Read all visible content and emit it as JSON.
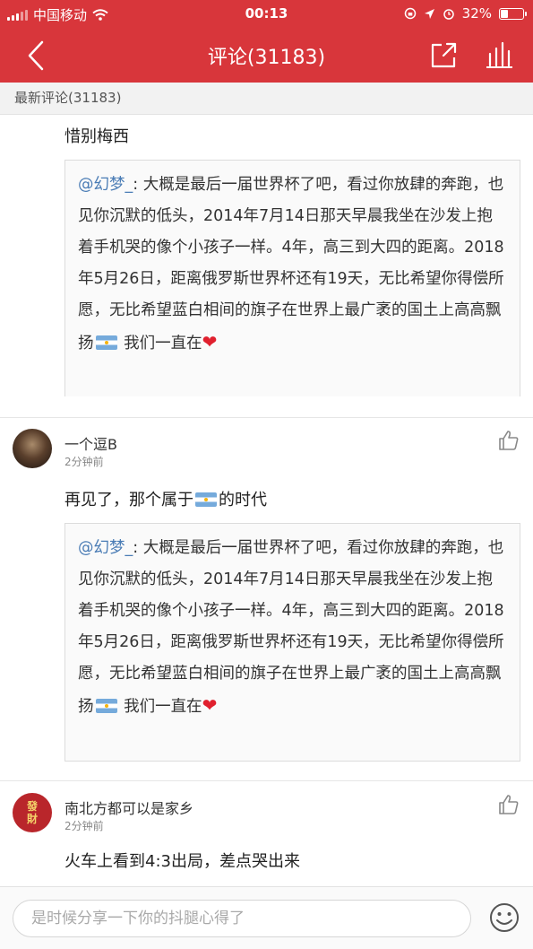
{
  "status": {
    "carrier": "中国移动",
    "time": "00:13",
    "battery_percent": "32%",
    "battery_level": 0.32
  },
  "header": {
    "title": "评论(31183)"
  },
  "section": {
    "label": "最新评论(31183)"
  },
  "comments": [
    {
      "text": "惜别梅西",
      "quote": {
        "mention": "@幻梦_",
        "body": ": 大概是最后一届世界杯了吧，看过你放肆的奔跑，也见你沉默的低头，2014年7月14日那天早晨我坐在沙发上抱着手机哭的像个小孩子一样。4年，高三到大四的距离。2018年5月26日，距离俄罗斯世界杯还有19天，无比希望你得偿所愿，无比希望蓝白相间的旗子在世界上最广袤的国土上高高飘扬",
        "tail": " 我们一直在"
      }
    },
    {
      "username": "一个逗B",
      "time": "2分钟前",
      "text_before": "再见了，那个属于",
      "text_after": "的时代",
      "quote": {
        "mention": "@幻梦_",
        "body": ": 大概是最后一届世界杯了吧，看过你放肆的奔跑，也见你沉默的低头，2014年7月14日那天早晨我坐在沙发上抱着手机哭的像个小孩子一样。4年，高三到大四的距离。2018年5月26日，距离俄罗斯世界杯还有19天，无比希望你得偿所愿，无比希望蓝白相间的旗子在世界上最广袤的国土上高高飘扬",
        "tail": " 我们一直在"
      }
    },
    {
      "username": "南北方都可以是家乡",
      "time": "2分钟前",
      "avatar_text_1": "發",
      "avatar_text_2": "財",
      "text": "火车上看到4:3出局，差点哭出来"
    }
  ],
  "input": {
    "placeholder": "是时候分享一下你的抖腿心得了"
  },
  "colors": {
    "brand_red": "#d8363b",
    "mention_blue": "#4a7cb5"
  },
  "icons": [
    "back-arrow-icon",
    "share-icon",
    "stats-icon",
    "thumbs-up-icon",
    "emoji-icon",
    "argentina-flag-icon",
    "heart-icon"
  ]
}
